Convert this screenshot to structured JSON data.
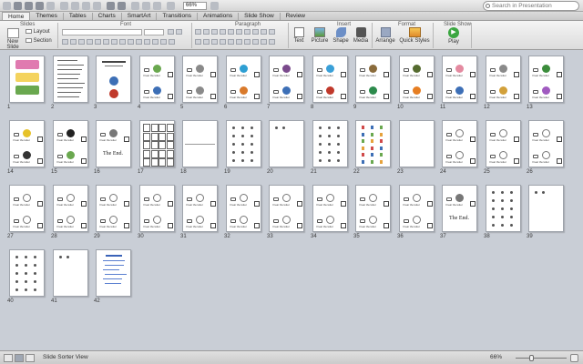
{
  "toolbar": {
    "zoom_value": "66%",
    "search_placeholder": "Search in Presentation"
  },
  "ribbon": {
    "tabs": [
      {
        "label": "Home",
        "active": true
      },
      {
        "label": "Themes"
      },
      {
        "label": "Tables"
      },
      {
        "label": "Charts"
      },
      {
        "label": "SmartArt"
      },
      {
        "label": "Transitions"
      },
      {
        "label": "Animations"
      },
      {
        "label": "Slide Show"
      },
      {
        "label": "Review"
      }
    ],
    "groups": {
      "slides": "Slides",
      "font": "Font",
      "paragraph": "Paragraph",
      "insert": "Insert",
      "format": "Format",
      "slide_show": "Slide Show"
    },
    "buttons": {
      "new_slide": "New Slide",
      "layout": "Layout",
      "section": "Section",
      "text": "Text",
      "picture": "Picture",
      "shape": "Shape",
      "media": "Media",
      "arrange": "Arrange",
      "quick_styles": "Quick Styles",
      "play": "Play"
    }
  },
  "slides": {
    "hear_text": "I hear the letter",
    "end_text": "The End.",
    "items": [
      {
        "n": "1",
        "kind": "title"
      },
      {
        "n": "2",
        "kind": "text"
      },
      {
        "n": "3",
        "kind": "title2"
      },
      {
        "n": "4",
        "kind": "two",
        "c1": "#6aa84f",
        "c2": "#3d6fb6"
      },
      {
        "n": "5",
        "kind": "two",
        "c1": "#8a8a8a",
        "c2": "#8a8a8a"
      },
      {
        "n": "6",
        "kind": "two",
        "c1": "#2e9fd3",
        "c2": "#d97a2b"
      },
      {
        "n": "7",
        "kind": "two",
        "c1": "#7a4a8c",
        "c2": "#3d6fb6"
      },
      {
        "n": "8",
        "kind": "two",
        "c1": "#3aa0d8",
        "c2": "#c0392b"
      },
      {
        "n": "9",
        "kind": "two",
        "c1": "#8a6b3b",
        "c2": "#2c8a4b"
      },
      {
        "n": "10",
        "kind": "two",
        "c1": "#556b2f",
        "c2": "#e67e22"
      },
      {
        "n": "11",
        "kind": "two",
        "c1": "#e48aa0",
        "c2": "#3d6fb6"
      },
      {
        "n": "12",
        "kind": "two",
        "c1": "#8a8a8a",
        "c2": "#d2a03a"
      },
      {
        "n": "13",
        "kind": "two",
        "c1": "#3b8c3b",
        "c2": "#a05ac0"
      },
      {
        "n": "14",
        "kind": "two",
        "c1": "#e6c229",
        "c2": "#333333"
      },
      {
        "n": "15",
        "kind": "two",
        "c1": "#222222",
        "c2": "#6aa84f"
      },
      {
        "n": "16",
        "kind": "end"
      },
      {
        "n": "17",
        "kind": "grid"
      },
      {
        "n": "18",
        "kind": "blank2"
      },
      {
        "n": "19",
        "kind": "letters"
      },
      {
        "n": "20",
        "kind": "yz"
      },
      {
        "n": "21",
        "kind": "letters"
      },
      {
        "n": "22",
        "kind": "cards"
      },
      {
        "n": "23",
        "kind": "blank"
      },
      {
        "n": "24",
        "kind": "outline"
      },
      {
        "n": "25",
        "kind": "outline"
      },
      {
        "n": "26",
        "kind": "outline"
      },
      {
        "n": "27",
        "kind": "outline"
      },
      {
        "n": "28",
        "kind": "outline"
      },
      {
        "n": "29",
        "kind": "outline"
      },
      {
        "n": "30",
        "kind": "outline"
      },
      {
        "n": "31",
        "kind": "outline"
      },
      {
        "n": "32",
        "kind": "outline"
      },
      {
        "n": "33",
        "kind": "outline"
      },
      {
        "n": "34",
        "kind": "outline"
      },
      {
        "n": "35",
        "kind": "outline"
      },
      {
        "n": "36",
        "kind": "outline"
      },
      {
        "n": "37",
        "kind": "end"
      },
      {
        "n": "38",
        "kind": "letters"
      },
      {
        "n": "39",
        "kind": "yz"
      },
      {
        "n": "40",
        "kind": "letters"
      },
      {
        "n": "41",
        "kind": "yz"
      },
      {
        "n": "42",
        "kind": "thanks"
      }
    ]
  },
  "statusbar": {
    "label": "Slide Sorter View",
    "zoom": "66%",
    "zoom_level_percent": 66
  }
}
